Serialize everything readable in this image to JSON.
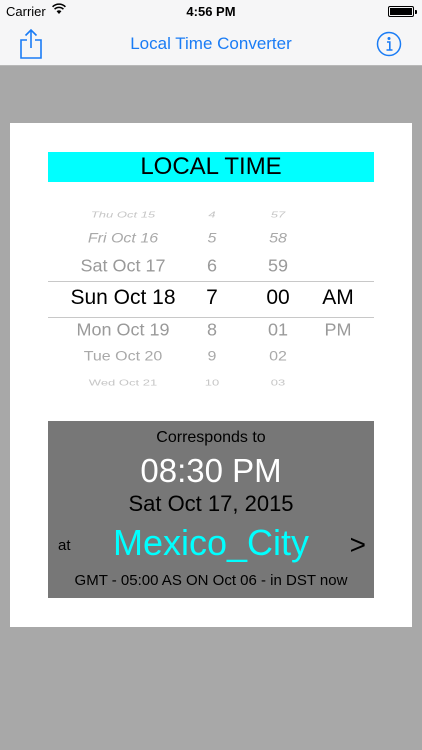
{
  "status_bar": {
    "carrier": "Carrier",
    "time": "4:56 PM",
    "battery_level": 1.0
  },
  "nav": {
    "title": "Local Time Converter",
    "share_icon": "share-icon",
    "info_icon": "info-icon"
  },
  "header": {
    "title": "LOCAL TIME"
  },
  "picker": {
    "rows": [
      {
        "date": "Thu Oct 15",
        "hour": "4",
        "minute": "57",
        "ampm": ""
      },
      {
        "date": "Fri Oct 16",
        "hour": "5",
        "minute": "58",
        "ampm": ""
      },
      {
        "date": "Sat Oct 17",
        "hour": "6",
        "minute": "59",
        "ampm": ""
      },
      {
        "date": "Sun Oct 18",
        "hour": "7",
        "minute": "00",
        "ampm": "AM"
      },
      {
        "date": "Mon Oct 19",
        "hour": "8",
        "minute": "01",
        "ampm": "PM"
      },
      {
        "date": "Tue Oct 20",
        "hour": "9",
        "minute": "02",
        "ampm": ""
      },
      {
        "date": "Wed Oct 21",
        "hour": "10",
        "minute": "03",
        "ampm": ""
      }
    ],
    "selected_index": 3
  },
  "result": {
    "corresponds_label": "Corresponds to",
    "time": "08:30 PM",
    "date": "Sat Oct 17, 2015",
    "at_label": "at",
    "city": "Mexico_City",
    "chevron": ">",
    "gmt_info": "GMT - 05:00 AS ON Oct 06 - in DST now"
  },
  "colors": {
    "accent": "#1a7cf5",
    "header_bg": "#00ffff",
    "city": "#00ffff",
    "panel_bg": "#777777",
    "page_bg": "#a8a8a8"
  }
}
